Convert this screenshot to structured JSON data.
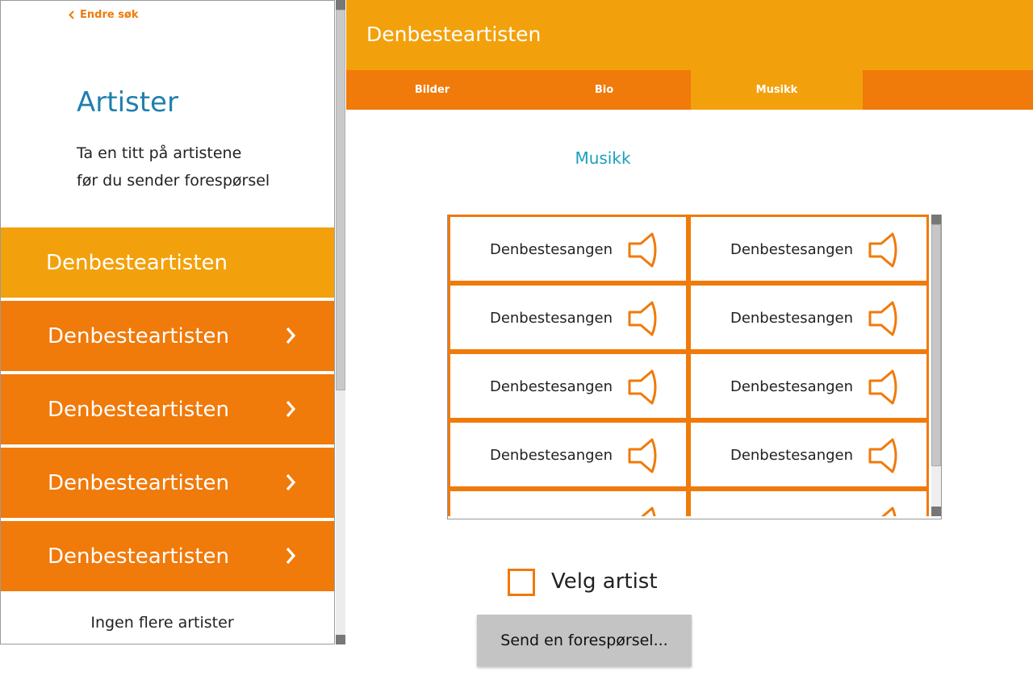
{
  "left_panel": {
    "back_link": "Endre søk",
    "title": "Artister",
    "description_line1": "Ta en titt på artistene",
    "description_line2": "før du sender forespørsel",
    "artists": [
      {
        "label": "Denbesteartisten",
        "active": true
      },
      {
        "label": "Denbesteartisten",
        "active": false
      },
      {
        "label": "Denbesteartisten",
        "active": false
      },
      {
        "label": "Denbesteartisten",
        "active": false
      },
      {
        "label": "Denbesteartisten",
        "active": false
      }
    ],
    "footer_text": "Ingen flere artister"
  },
  "header": {
    "title": "Denbesteartisten"
  },
  "tabs": [
    {
      "label": "Bilder",
      "active": false
    },
    {
      "label": "Bio",
      "active": false
    },
    {
      "label": "Musikk",
      "active": true
    }
  ],
  "main": {
    "section_heading": "Musikk",
    "songs": [
      "Denbestesangen",
      "Denbestesangen",
      "Denbestesangen",
      "Denbestesangen",
      "Denbestesangen",
      "Denbestesangen",
      "Denbestesangen",
      "Denbestesangen",
      "",
      ""
    ],
    "song_icon": "speaker-icon",
    "checkbox_label": "Velg artist",
    "checkbox_checked": false,
    "send_button": "Send en forespørsel..."
  },
  "colors": {
    "accent_orange": "#f07a0a",
    "accent_yellow": "#f2a10c",
    "title_blue": "#1f7fae",
    "heading_teal": "#1a9fbf",
    "button_gray": "#c4c4c4"
  }
}
